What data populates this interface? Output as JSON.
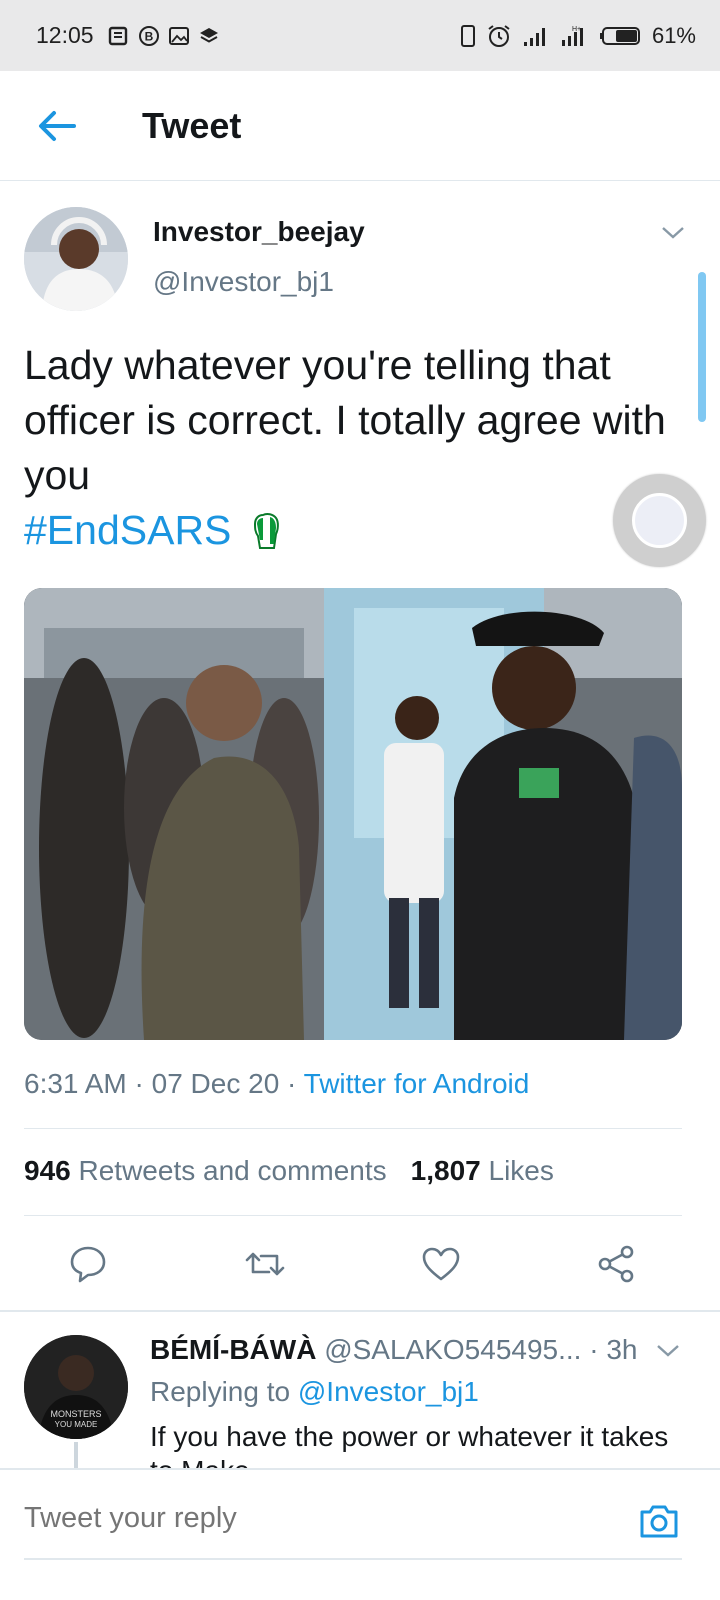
{
  "status_bar": {
    "time": "12:05",
    "battery": "61%",
    "icons": [
      "notes-icon",
      "b-circle-icon",
      "image-icon",
      "layers-icon",
      "phone-outline-icon",
      "alarm-icon",
      "signal-icon",
      "signal-hplus-icon",
      "battery-icon"
    ]
  },
  "header": {
    "title": "Tweet",
    "back_icon": "arrow-left-icon"
  },
  "tweet": {
    "display_name": "Investor_beejay",
    "handle": "@Investor_bj1",
    "text": "Lady whatever you're telling that officer is correct. I totally agree with you",
    "hashtag": "#EndSARS",
    "emoji": "raised-fist-green-icon",
    "time": "6:31 AM",
    "date": "07 Dec 20",
    "source": "Twitter for Android",
    "retweets_count": "946",
    "retweets_label": "Retweets and comments",
    "likes_count": "1,807",
    "likes_label": "Likes",
    "sep": "·"
  },
  "actions": [
    "reply-icon",
    "retweet-icon",
    "like-icon",
    "share-icon"
  ],
  "reply": {
    "display_name": "BÉMÍ-BÁWÀ",
    "handle": "@SALAKO545495...",
    "age": "· 3h",
    "replying_prefix": "Replying to",
    "replying_to": "@Investor_bj1",
    "text": "If you have the power or whatever it takes to Make"
  },
  "composer": {
    "placeholder": "Tweet your reply"
  },
  "colors": {
    "accent": "#1b95e0",
    "text": "#14171a",
    "secondary": "#657786",
    "divider": "#e1e8ed"
  }
}
